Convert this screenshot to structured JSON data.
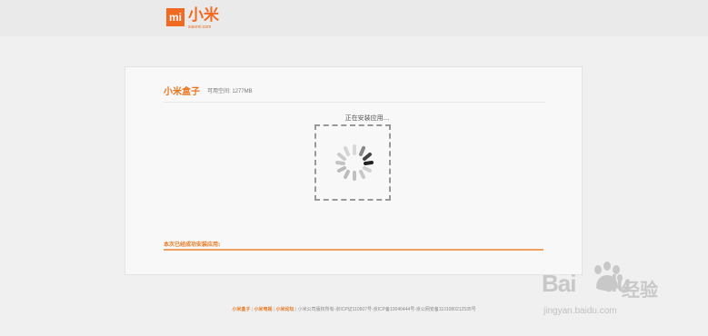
{
  "header": {
    "logo_mark": "mi",
    "logo_text": "小米",
    "logo_url": "xiaomi.com",
    "brand_color": "#f26a21"
  },
  "card": {
    "title": "小米盒子",
    "space_label": "可用空间: 1277MB",
    "installing_text": "正在安装应用...",
    "spinner_icon": "loading-spinner-icon",
    "done_label": "本次已经成功安装应用:",
    "progress": 1.0
  },
  "footer": {
    "link1": "小米盒子",
    "link2": "小米电视",
    "link3": "小米论坛",
    "separator": "|",
    "copyright": "小米公司版权所有-京ICP证110507号-京ICP备10046444号-京公网安备1101080212535号"
  },
  "watermark": {
    "brand": "Bai",
    "brand2": "du",
    "paw_icon": "baidu-paw-icon",
    "suffix": "经验",
    "url": "jingyan.baidu.com"
  }
}
